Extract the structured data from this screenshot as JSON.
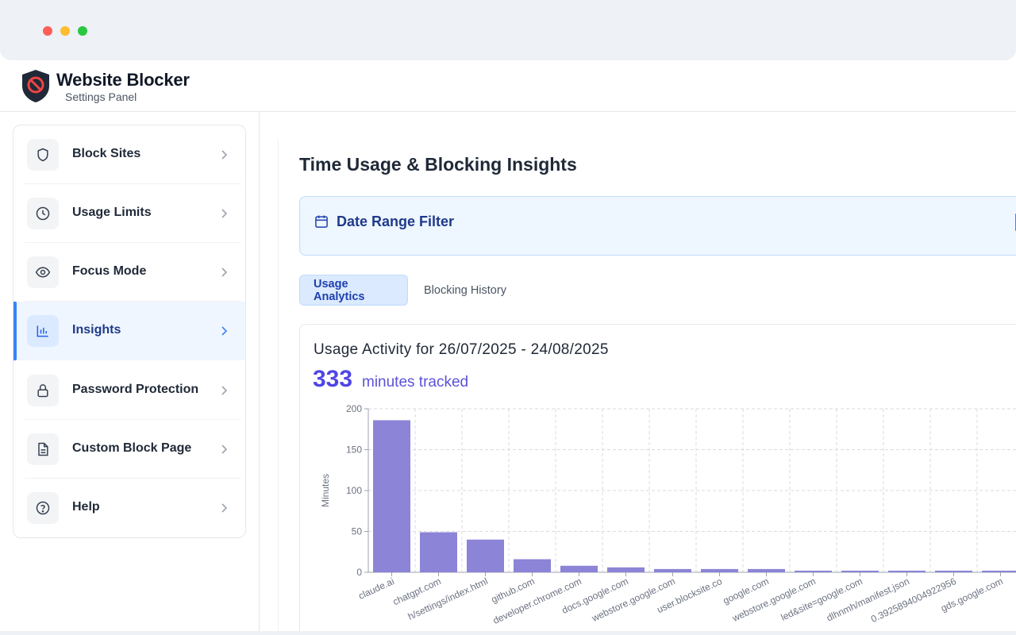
{
  "app": {
    "title": "Website Blocker",
    "subtitle": "Settings Panel",
    "accent": "#3b82f6",
    "logo_icon": "no-entry-shield-icon"
  },
  "sidebar": {
    "items": [
      {
        "key": "block-sites",
        "label": "Block Sites",
        "icon": "shield-icon",
        "active": false
      },
      {
        "key": "usage-limits",
        "label": "Usage Limits",
        "icon": "clock-icon",
        "active": false
      },
      {
        "key": "focus-mode",
        "label": "Focus Mode",
        "icon": "eye-icon",
        "active": false
      },
      {
        "key": "insights",
        "label": "Insights",
        "icon": "bar-chart-icon",
        "active": true
      },
      {
        "key": "password-protection",
        "label": "Password Protection",
        "icon": "lock-icon",
        "active": false
      },
      {
        "key": "custom-block-page",
        "label": "Custom Block Page",
        "icon": "document-icon",
        "active": false
      },
      {
        "key": "help",
        "label": "Help",
        "icon": "help-circle-icon",
        "active": false
      }
    ]
  },
  "main": {
    "page_title": "Time Usage & Blocking Insights",
    "date_filter_label": "Date Range Filter",
    "tabs": [
      {
        "label": "Usage Analytics",
        "active": true
      },
      {
        "label": "Blocking History",
        "active": false
      }
    ],
    "usage": {
      "title": "Usage Activity for 26/07/2025 - 24/08/2025",
      "total": "333",
      "unit": "minutes tracked"
    }
  },
  "chart_data": {
    "type": "bar",
    "ylabel": "Minutes",
    "ylim": [
      0,
      200
    ],
    "yticks": [
      0,
      50,
      100,
      150,
      200
    ],
    "grid": true,
    "bar_color": "#8b84d7",
    "categories": [
      "claude.ai",
      "chatgpt.com",
      "h/settings/index.html",
      "github.com",
      "developer.chrome.com",
      "docs.google.com",
      "webstore.google.com",
      "user.blocksite.co",
      "google.com",
      "webstore.google.com",
      "led&site=google.com",
      "dlhnmh/manifest.json",
      "0.3925894004922956",
      "gds.google.com",
      ""
    ],
    "values": [
      186,
      49,
      40,
      16,
      8,
      6,
      4,
      4,
      4,
      2,
      2,
      2,
      2,
      2,
      2
    ]
  }
}
